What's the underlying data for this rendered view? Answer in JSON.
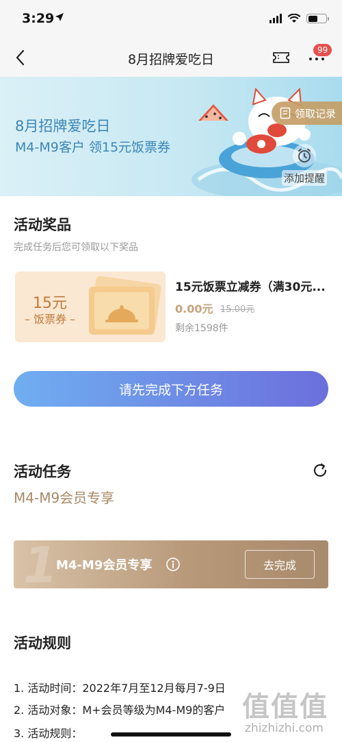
{
  "status_bar": {
    "time": "3:29",
    "location_icon": "location-arrow-icon",
    "signal_icon": "cellular-signal-icon",
    "wifi_icon": "wifi-icon",
    "battery_icon": "battery-icon"
  },
  "nav": {
    "title": "8月招牌爱吃日",
    "back_icon": "chevron-left-icon",
    "ticket_icon": "ticket-icon",
    "more_icon": "more-dots-icon",
    "badge": "99"
  },
  "banner": {
    "title": "8月招牌爱吃日",
    "subtitle": "M4-M9客户  领15元饭票券",
    "record_label": "领取记录",
    "remind_label": "添加提醒",
    "background_color": "#c7e8f3"
  },
  "prizes": {
    "title": "活动奖品",
    "subtitle": "完成任务后您可领取以下奖品",
    "coupon_amount": "15元",
    "coupon_label": "– 饭票券 –",
    "items": [
      {
        "name": "15元饭票立减券（满30元...",
        "price": "0.00元",
        "original_price": "15.00元",
        "stock": "剩余1598件"
      }
    ]
  },
  "main_button": {
    "label": "请先完成下方任务",
    "gradient": [
      "#70aef1",
      "#6c6fdc"
    ]
  },
  "tasks": {
    "title": "活动任务",
    "refresh_icon": "refresh-icon",
    "group": "M4-M9会员专享",
    "items": [
      {
        "number": "1",
        "name": "M4-M9会员专享",
        "info_icon": "info-icon",
        "action": "去完成"
      }
    ]
  },
  "rules": {
    "title": "活动规则",
    "lines": [
      "1. 活动时间：2022年7月至12月每月7-9日",
      "2. 活动对象：M+会员等级为M4-M9的客户",
      "3. 活动规则："
    ]
  },
  "watermark": {
    "glyphs": "值值值",
    "site": "zhizhizhi.com"
  }
}
